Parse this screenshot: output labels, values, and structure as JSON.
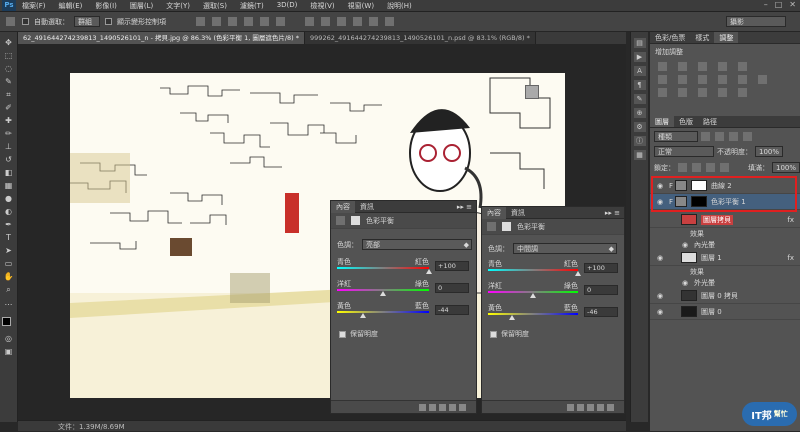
{
  "app": {
    "logo": "Ps"
  },
  "menu": [
    "檔案(F)",
    "編輯(E)",
    "影像(I)",
    "圖層(L)",
    "文字(Y)",
    "選取(S)",
    "濾鏡(T)",
    "3D(D)",
    "檢視(V)",
    "視窗(W)",
    "說明(H)"
  ],
  "options": {
    "auto_select": "自動選取：",
    "auto_select_value": "群組",
    "transform_controls": "顯示變形控制項",
    "workspace": "攝影"
  },
  "tabs": [
    "62_491644274239813_1490526101_n - 拷貝.jpg @ 86.3% (色彩平衡 1, 圖層遮色片/8) *",
    "999262_491644274239813_1490526101_n.psd @ 83.1% (RGB/8) *"
  ],
  "status": {
    "doc": "文件：1.39M/8.69M"
  },
  "panel1": {
    "tabs": [
      "內容",
      "資訊"
    ],
    "title": "色彩平衡",
    "tone_label": "色調：",
    "tone_value": "亮部",
    "sliders": [
      {
        "left": "青色",
        "right": "紅色",
        "value": "+100",
        "pos": 1.0
      },
      {
        "left": "洋紅",
        "right": "綠色",
        "value": "0",
        "pos": 0.5
      },
      {
        "left": "黃色",
        "right": "藍色",
        "value": "-44",
        "pos": 0.28
      }
    ],
    "preserve": "保留明度"
  },
  "panel2": {
    "tabs": [
      "內容",
      "資訊"
    ],
    "title": "色彩平衡",
    "tone_label": "色調：",
    "tone_value": "中間調",
    "sliders": [
      {
        "left": "青色",
        "right": "紅色",
        "value": "+100",
        "pos": 1.0
      },
      {
        "left": "洋紅",
        "right": "綠色",
        "value": "0",
        "pos": 0.5
      },
      {
        "left": "黃色",
        "right": "藍色",
        "value": "-46",
        "pos": 0.27
      }
    ],
    "preserve": "保留明度"
  },
  "right": {
    "tabs1": [
      "色彩/色票",
      "樣式",
      "調整"
    ],
    "adjust_title": "增加調整",
    "tabs2": [
      "圖層",
      "色版",
      "路徑"
    ],
    "kind": "種類",
    "blend": "正常",
    "opacity_label": "不透明度：",
    "opacity": "100%",
    "lock_label": "鎖定：",
    "fill_label": "填滿：",
    "fill": "100%",
    "layers": [
      {
        "name": "曲線 2",
        "type": "adj"
      },
      {
        "name": "色彩平衡 1",
        "type": "adj"
      },
      {
        "name": "圖層拷貝",
        "type": "img",
        "fx": "fx"
      },
      {
        "name": "圖層 1",
        "type": "img",
        "fx": "fx"
      },
      {
        "name": "圖層 0 拷貝",
        "type": "img"
      },
      {
        "name": "圖層 0",
        "type": "img"
      }
    ],
    "effects1": [
      "效果",
      "內光暈"
    ],
    "effects2": [
      "效果",
      "外光暈"
    ]
  },
  "watermark": {
    "text": "IT邦",
    "text2": "幫忙"
  }
}
